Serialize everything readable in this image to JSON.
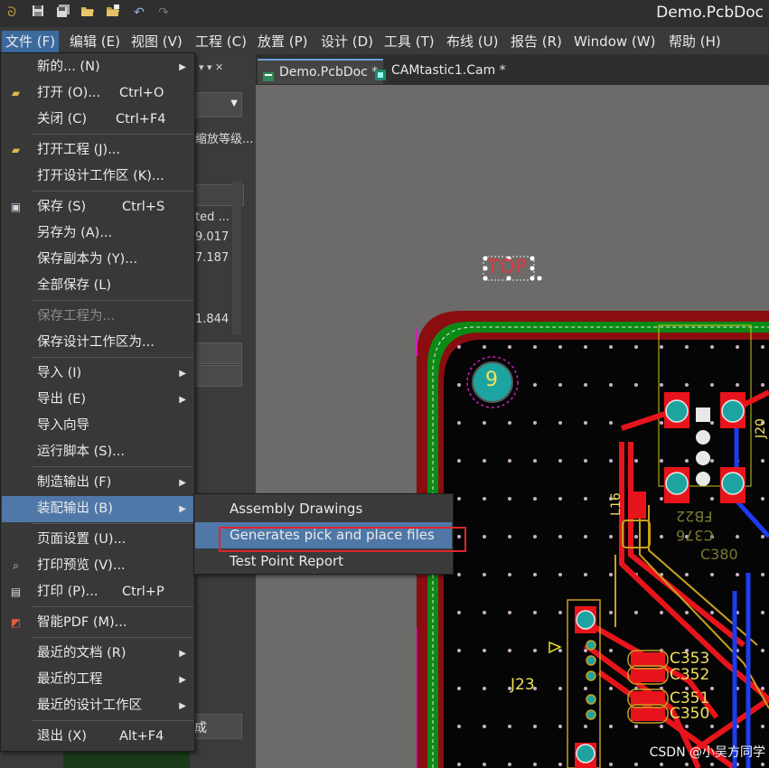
{
  "window": {
    "doc_title": "Demo.PcbDoc"
  },
  "quick_access": [
    "app-logo-icon",
    "save-icon",
    "save-all-icon",
    "open-icon",
    "open-project-icon",
    "undo-icon",
    "redo-icon"
  ],
  "menubar": [
    {
      "label": "文件 (F)",
      "active": true
    },
    {
      "label": "编辑 (E)"
    },
    {
      "label": "视图 (V)"
    },
    {
      "label": "工程 (C)"
    },
    {
      "label": "放置 (P)"
    },
    {
      "label": "设计 (D)"
    },
    {
      "label": "工具 (T)"
    },
    {
      "label": "布线 (U)"
    },
    {
      "label": "报告 (R)"
    },
    {
      "label": "Window (W)"
    },
    {
      "label": "帮助 (H)"
    }
  ],
  "tabs": [
    {
      "label": "Demo.PcbDoc *",
      "selected": true
    },
    {
      "label": "CAMtastic1.Cam *",
      "selected": false
    }
  ],
  "left_panel": {
    "zoom_button": "缩放等级...",
    "col_header": "ted ...",
    "values": [
      "9.017",
      "7.187",
      "1.844"
    ],
    "bottom_button": "成"
  },
  "file_menu": {
    "items": [
      {
        "label": "新的... (N)",
        "shortcut": "",
        "submenu": true
      },
      {
        "label": "打开 (O)...",
        "shortcut": "Ctrl+O",
        "icon": "open-folder-icon"
      },
      {
        "label": "关闭 (C)",
        "shortcut": "Ctrl+F4"
      },
      {
        "label": "打开工程 (J)...",
        "icon": "open-project-icon"
      },
      {
        "label": "打开设计工作区 (K)..."
      },
      {
        "label": "保存 (S)",
        "shortcut": "Ctrl+S",
        "icon": "save-icon"
      },
      {
        "label": "另存为 (A)..."
      },
      {
        "label": "保存副本为 (Y)..."
      },
      {
        "label": "全部保存 (L)"
      },
      {
        "label": "保存工程为...",
        "disabled": true
      },
      {
        "label": "保存设计工作区为..."
      },
      {
        "label": "导入 (I)",
        "submenu": true
      },
      {
        "label": "导出 (E)",
        "submenu": true
      },
      {
        "label": "导入向导"
      },
      {
        "label": "运行脚本 (S)..."
      },
      {
        "label": "制造输出 (F)",
        "submenu": true
      },
      {
        "label": "装配输出 (B)",
        "submenu": true,
        "highlighted": true
      },
      {
        "label": "页面设置 (U)..."
      },
      {
        "label": "打印预览 (V)...",
        "icon": "print-preview-icon"
      },
      {
        "label": "打印 (P)...",
        "shortcut": "Ctrl+P",
        "icon": "printer-icon"
      },
      {
        "label": "智能PDF (M)...",
        "icon": "smart-pdf-icon"
      },
      {
        "label": "最近的文档 (R)",
        "submenu": true
      },
      {
        "label": "最近的工程",
        "submenu": true
      },
      {
        "label": "最近的设计工作区",
        "submenu": true
      },
      {
        "label": "退出 (X)",
        "shortcut": "Alt+F4"
      }
    ]
  },
  "assembly_submenu": {
    "items": [
      {
        "label": "Assembly Drawings"
      },
      {
        "label": "Generates pick and place files",
        "highlighted": true
      },
      {
        "label": "Test Point Report"
      }
    ]
  },
  "pcb": {
    "top_label": "TOP",
    "pad_number": "9",
    "labels": [
      "FB22",
      "C376",
      "C380",
      "C353",
      "C352",
      "C351",
      "C350",
      "J23",
      "L16",
      "J20"
    ]
  },
  "watermark": "CSDN @小吴方同学"
}
